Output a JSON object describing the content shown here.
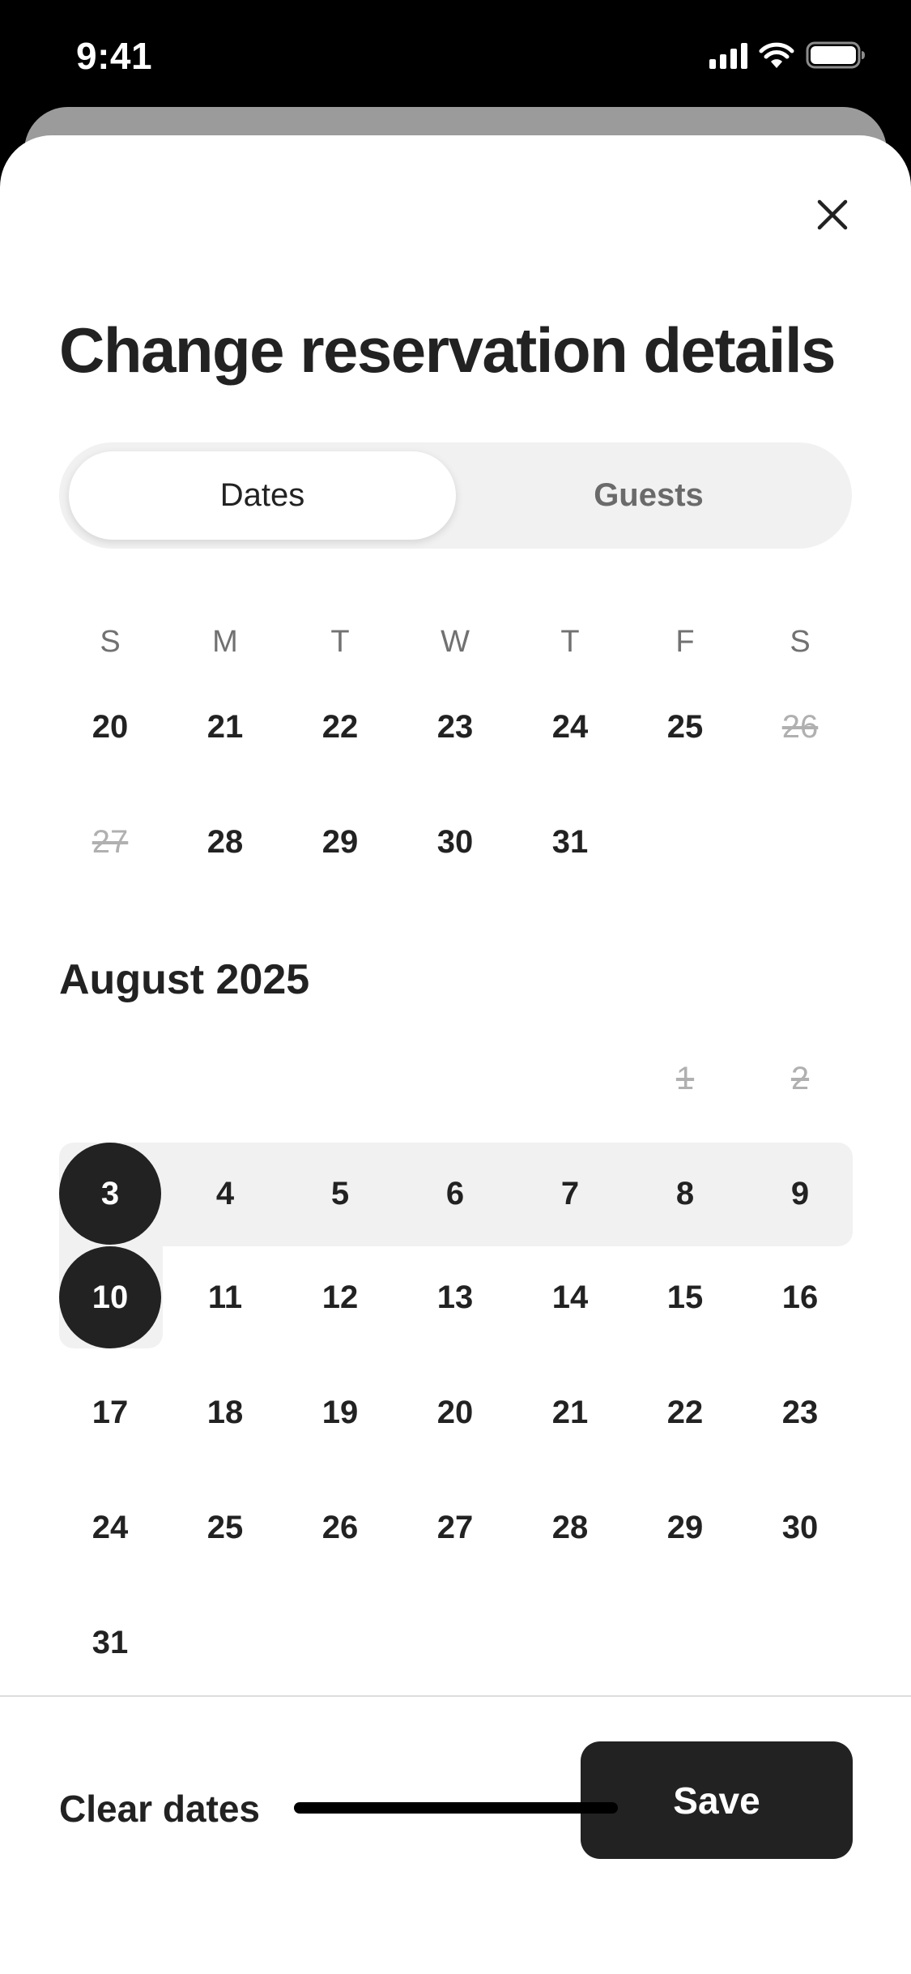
{
  "status": {
    "time": "9:41"
  },
  "sheet": {
    "title": "Change reservation details"
  },
  "tabs": [
    {
      "label": "Dates",
      "active": true
    },
    {
      "label": "Guests",
      "active": false
    }
  ],
  "weekdays": [
    "S",
    "M",
    "T",
    "W",
    "T",
    "F",
    "S"
  ],
  "july_tail": {
    "rows": [
      [
        "20",
        "21",
        "22",
        "23",
        "24",
        "25",
        "26"
      ],
      [
        "27",
        "28",
        "29",
        "30",
        "31",
        "",
        ""
      ]
    ],
    "blocked": [
      "26",
      "27"
    ]
  },
  "august": {
    "title": "August 2025",
    "rows": [
      [
        "",
        "",
        "",
        "",
        "",
        "1",
        "2"
      ],
      [
        "3",
        "4",
        "5",
        "6",
        "7",
        "8",
        "9"
      ],
      [
        "10",
        "11",
        "12",
        "13",
        "14",
        "15",
        "16"
      ],
      [
        "17",
        "18",
        "19",
        "20",
        "21",
        "22",
        "23"
      ],
      [
        "24",
        "25",
        "26",
        "27",
        "28",
        "29",
        "30"
      ],
      [
        "31",
        "",
        "",
        "",
        "",
        "",
        ""
      ]
    ],
    "blocked": [
      "1",
      "2"
    ],
    "check_in": "3",
    "check_out": "10"
  },
  "footer": {
    "clear_label": "Clear dates",
    "save_label": "Save"
  }
}
